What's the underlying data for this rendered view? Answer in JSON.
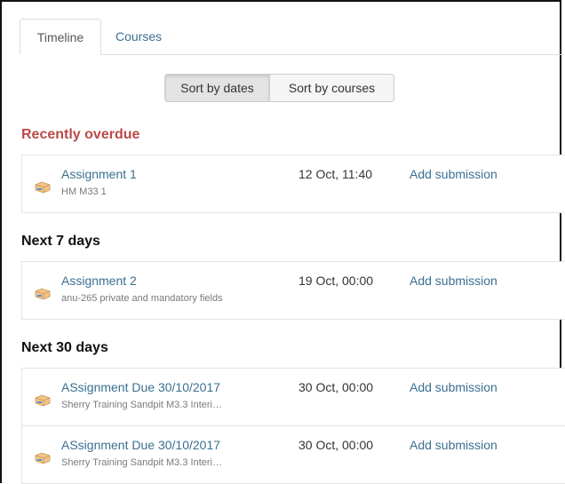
{
  "tabs": {
    "timeline": "Timeline",
    "courses": "Courses"
  },
  "sort": {
    "by_dates": "Sort by dates",
    "by_courses": "Sort by courses"
  },
  "sections": [
    {
      "heading": "Recently overdue",
      "heading_color": "#b94a48",
      "events": [
        {
          "name": "Assignment 1",
          "course": "HM M33 1",
          "date": "12 Oct, 11:40",
          "action": "Add submission",
          "icon": "assignment-icon"
        }
      ]
    },
    {
      "heading": "Next 7 days",
      "events": [
        {
          "name": "Assignment 2",
          "course": "anu-265 private and mandatory fields",
          "date": "19 Oct, 00:00",
          "action": "Add submission",
          "icon": "assignment-icon"
        }
      ]
    },
    {
      "heading": "Next 30 days",
      "events": [
        {
          "name": "ASsignment Due 30/10/2017",
          "course": "Sherry Training Sandpit M3.3 Interi…",
          "date": "30 Oct, 00:00",
          "action": "Add submission",
          "icon": "assignment-icon"
        },
        {
          "name": "ASsignment Due 30/10/2017",
          "course": "Sherry Training Sandpit M3.3 Interi…",
          "date": "30 Oct, 00:00",
          "action": "Add submission",
          "icon": "assignment-icon"
        }
      ]
    }
  ],
  "colors": {
    "link": "#3a6f8f",
    "overdue": "#b94a48"
  }
}
